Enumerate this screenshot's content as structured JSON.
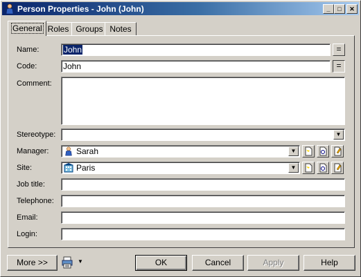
{
  "window": {
    "title": "Person Properties - John (John)",
    "controls": [
      "minimize-icon",
      "maximize-icon",
      "close-icon"
    ]
  },
  "tabs": [
    {
      "label": "General",
      "active": true
    },
    {
      "label": "Roles",
      "active": false
    },
    {
      "label": "Groups",
      "active": false
    },
    {
      "label": "Notes",
      "active": false
    }
  ],
  "form": {
    "name": {
      "label": "Name:",
      "value": "John"
    },
    "code": {
      "label": "Code:",
      "value": "John"
    },
    "comment": {
      "label": "Comment:",
      "value": ""
    },
    "stereotype": {
      "label": "Stereotype:",
      "value": ""
    },
    "manager": {
      "label": "Manager:",
      "value": "Sarah",
      "icon": "person-icon"
    },
    "site": {
      "label": "Site:",
      "value": "Paris",
      "icon": "building-icon"
    },
    "job_title": {
      "label": "Job title:",
      "value": ""
    },
    "telephone": {
      "label": "Telephone:",
      "value": ""
    },
    "email": {
      "label": "Email:",
      "value": ""
    },
    "login": {
      "label": "Login:",
      "value": ""
    },
    "equal_button": "="
  },
  "buttons": {
    "more": "More >>",
    "ok": "OK",
    "cancel": "Cancel",
    "apply": "Apply",
    "help": "Help"
  },
  "colors": {
    "titlebar_start": "#0a246a",
    "titlebar_end": "#a6caf0",
    "face": "#d4d0c8"
  }
}
